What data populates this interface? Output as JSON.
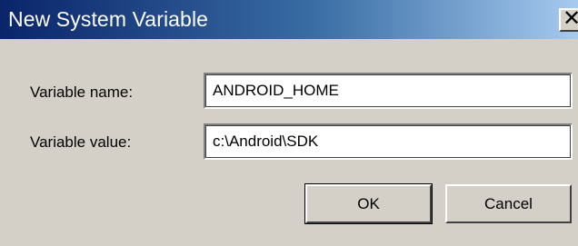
{
  "window": {
    "title": "New System Variable",
    "close_glyph": "✕"
  },
  "form": {
    "name_label": "Variable name:",
    "name_value": "ANDROID_HOME",
    "value_label": "Variable value:",
    "value_value": "c:\\Android\\SDK"
  },
  "buttons": {
    "ok_label": "OK",
    "cancel_label": "Cancel"
  },
  "colors": {
    "titlebar_start": "#0a246a",
    "titlebar_end": "#a6caf0",
    "dialog_background": "#d4d0c8"
  },
  "icons": {
    "close": "close-icon"
  }
}
